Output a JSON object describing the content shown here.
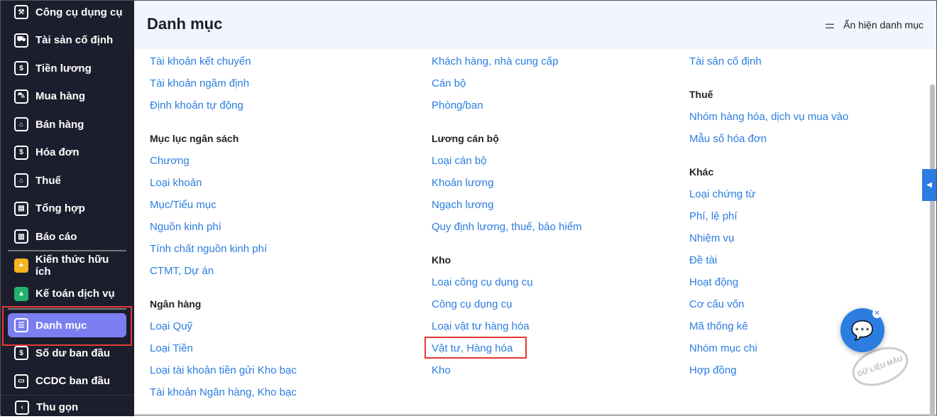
{
  "sidebar": {
    "items": [
      {
        "label": "Công cụ dụng cụ",
        "icon": "tools-icon"
      },
      {
        "label": "Tài sản cố định",
        "icon": "truck-icon"
      },
      {
        "label": "Tiền lương",
        "icon": "salary-bag-icon"
      },
      {
        "label": "Mua hàng",
        "icon": "cart-icon"
      },
      {
        "label": "Bán hàng",
        "icon": "store-icon"
      },
      {
        "label": "Hóa đơn",
        "icon": "invoice-icon"
      },
      {
        "label": "Thuế",
        "icon": "bank-icon"
      },
      {
        "label": "Tổng hợp",
        "icon": "summary-icon"
      },
      {
        "label": "Báo cáo",
        "icon": "report-chart-icon"
      },
      {
        "label": "Kiến thức hữu ích",
        "icon": "knowledge-icon"
      },
      {
        "label": "Kế toán dịch vụ",
        "icon": "service-icon"
      },
      {
        "label": "Danh mục",
        "icon": "catalog-icon"
      },
      {
        "label": "Số dư ban đầu",
        "icon": "balance-icon"
      },
      {
        "label": "CCDC ban đầu",
        "icon": "devices-icon"
      }
    ],
    "collapse": "Thu gọn"
  },
  "header": {
    "title": "Danh mục",
    "toggle": "Ẩn hiện danh mục"
  },
  "col1": {
    "items": [
      "Tài khoản kết chuyển",
      "Tài khoản ngầm định",
      "Định khoản tự động"
    ],
    "g2": {
      "title": "Mục lục ngân sách",
      "items": [
        "Chương",
        "Loại khoản",
        "Mục/Tiểu mục",
        "Nguồn kinh phí",
        "Tính chất nguồn kinh phí",
        "CTMT, Dự án"
      ]
    },
    "g3": {
      "title": "Ngân hàng",
      "items": [
        "Loại Quỹ",
        "Loại Tiền",
        "Loại tài khoản tiền gửi Kho bạc",
        "Tài khoản Ngân hàng, Kho bạc"
      ]
    }
  },
  "col2": {
    "items": [
      "Khách hàng, nhà cung cấp",
      "Cán bộ",
      "Phòng/ban"
    ],
    "g2": {
      "title": "Lương cán bộ",
      "items": [
        "Loại cán bộ",
        "Khoản lương",
        "Ngạch lương",
        "Quy định lương, thuế, bảo hiểm"
      ]
    },
    "g3": {
      "title": "Kho",
      "items": [
        "Loại công cụ dụng cụ",
        "Công cụ dụng cụ",
        "Loại vật tư hàng hóa",
        "Vật tư, Hàng hóa",
        "Kho"
      ]
    }
  },
  "col3": {
    "items": [
      "Tài sản cố định"
    ],
    "g2": {
      "title": "Thuế",
      "items": [
        "Nhóm hàng hóa, dịch vụ mua vào",
        "Mẫu số hóa đơn"
      ]
    },
    "g3": {
      "title": "Khác",
      "items": [
        "Loại chứng từ",
        "Phí, lệ phí",
        "Nhiệm vụ",
        "Đề tài",
        "Hoạt động",
        "Cơ cấu vốn",
        "Mã thống kê",
        "Nhóm mục chi",
        "Hợp đồng"
      ]
    }
  },
  "stamp": "DỮ LIỆU MẪU"
}
